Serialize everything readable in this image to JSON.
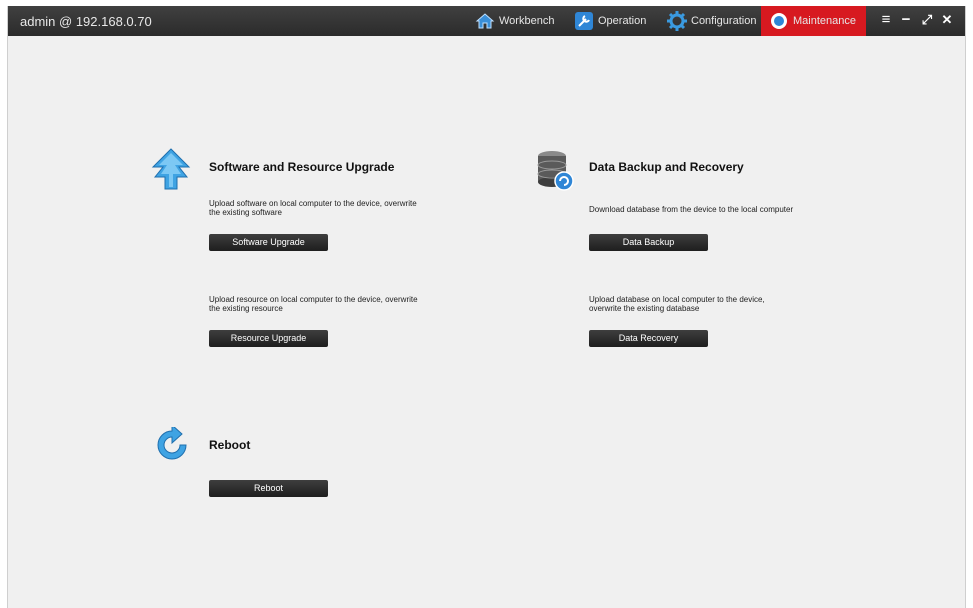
{
  "window": {
    "title": "admin @ 192.168.0.70"
  },
  "nav": {
    "workbench": "Workbench",
    "operation": "Operation",
    "configuration": "Configuration",
    "maintenance": "Maintenance"
  },
  "window_controls": {
    "menu": "≡",
    "minimize": "−",
    "maximize": "⤢",
    "close": "✕"
  },
  "upgrade": {
    "title": "Software and Resource Upgrade",
    "software_desc_1": "Upload software on local computer to the device, overwrite",
    "software_desc_2": "the existing software",
    "software_button": "Software Upgrade",
    "resource_desc_1": "Upload resource on local computer to the device, overwrite",
    "resource_desc_2": "the existing resource",
    "resource_button": "Resource Upgrade"
  },
  "backup": {
    "title": "Data Backup and Recovery",
    "backup_desc": "Download database from the device to the local computer",
    "backup_button": "Data Backup",
    "recovery_desc_1": "Upload database on local computer to the device,",
    "recovery_desc_2": "overwrite the existing database",
    "recovery_button": "Data Recovery"
  },
  "reboot": {
    "title": "Reboot",
    "button": "Reboot"
  },
  "colors": {
    "titlebar": "#2f2f2f",
    "active_tab": "#d71920",
    "background": "#f0f0f0",
    "button": "#2a2a2a"
  },
  "icons": [
    "home-icon",
    "wrench-icon",
    "gear-icon",
    "maintenance-icon",
    "upgrade-arrow-icon",
    "database-icon",
    "reboot-icon"
  ]
}
